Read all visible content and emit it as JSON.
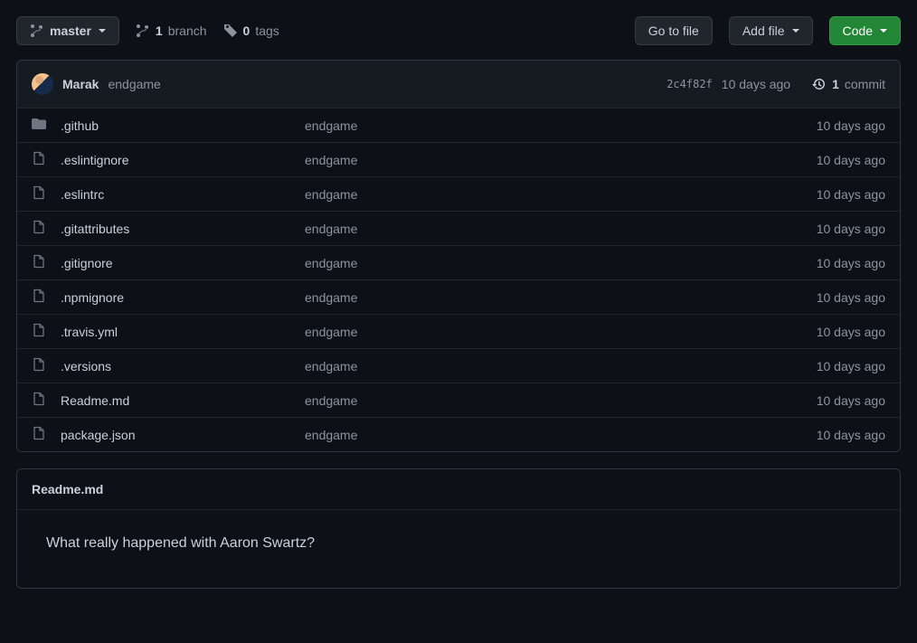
{
  "toolbar": {
    "branch": "master",
    "branch_count": "1",
    "branch_label": "branch",
    "tag_count": "0",
    "tag_label": "tags",
    "goto_file": "Go to file",
    "add_file": "Add file",
    "code": "Code"
  },
  "commit": {
    "author": "Marak",
    "message": "endgame",
    "sha": "2c4f82f",
    "time": "10 days ago",
    "count": "1",
    "count_label": "commit"
  },
  "files": [
    {
      "type": "dir",
      "name": ".github",
      "msg": "endgame",
      "time": "10 days ago"
    },
    {
      "type": "file",
      "name": ".eslintignore",
      "msg": "endgame",
      "time": "10 days ago"
    },
    {
      "type": "file",
      "name": ".eslintrc",
      "msg": "endgame",
      "time": "10 days ago"
    },
    {
      "type": "file",
      "name": ".gitattributes",
      "msg": "endgame",
      "time": "10 days ago"
    },
    {
      "type": "file",
      "name": ".gitignore",
      "msg": "endgame",
      "time": "10 days ago"
    },
    {
      "type": "file",
      "name": ".npmignore",
      "msg": "endgame",
      "time": "10 days ago"
    },
    {
      "type": "file",
      "name": ".travis.yml",
      "msg": "endgame",
      "time": "10 days ago"
    },
    {
      "type": "file",
      "name": ".versions",
      "msg": "endgame",
      "time": "10 days ago"
    },
    {
      "type": "file",
      "name": "Readme.md",
      "msg": "endgame",
      "time": "10 days ago"
    },
    {
      "type": "file",
      "name": "package.json",
      "msg": "endgame",
      "time": "10 days ago"
    }
  ],
  "readme": {
    "filename": "Readme.md",
    "heading": "What really happened with Aaron Swartz?"
  }
}
